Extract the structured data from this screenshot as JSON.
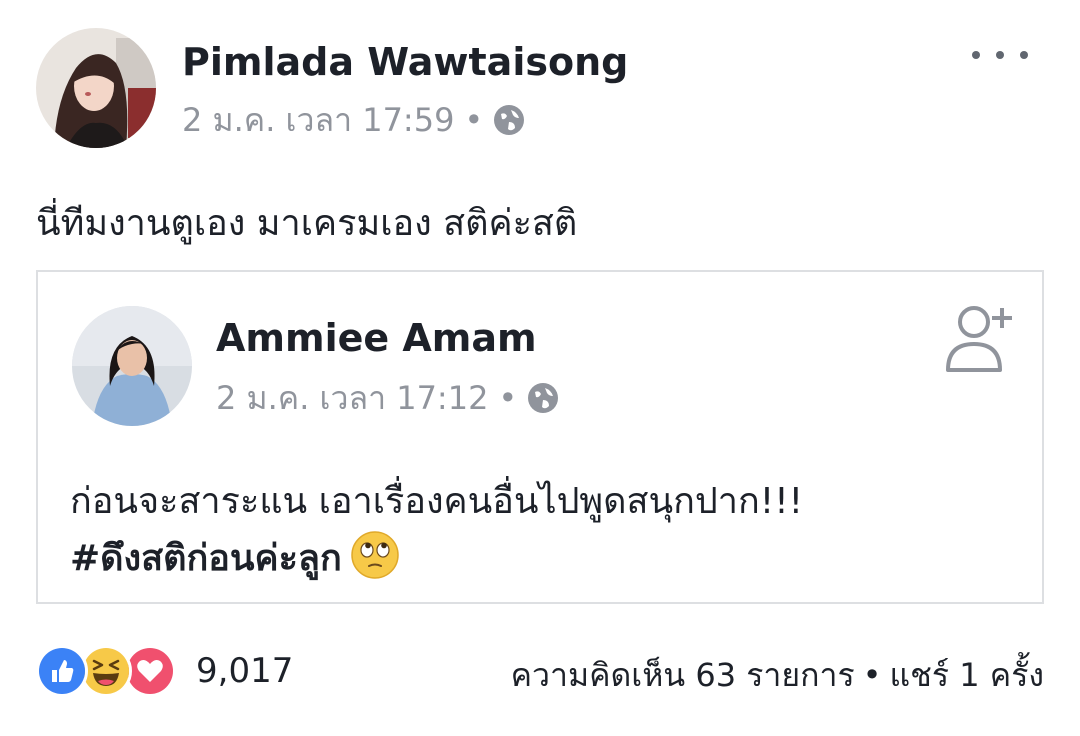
{
  "post": {
    "author": "Pimlada Wawtaisong",
    "timestamp": "2 ม.ค. เวลา 17:59",
    "separator": "•",
    "privacy_icon": "globe-icon",
    "text": "นี่ทีมงานตูเอง มาเครมเอง สติค่ะสติ",
    "more_icon": "more-options-icon"
  },
  "shared_post": {
    "author": "Ammiee Amam",
    "timestamp": "2 ม.ค. เวลา 17:12",
    "separator": "•",
    "privacy_icon": "globe-icon",
    "text_line1": "ก่อนจะสาระแน เอาเรื่องคนอื่นไปพูดสนุกปาก!!!",
    "hashtag": "#ดึงสติก่อนค่ะลูก",
    "emoji": "eye-roll-emoji",
    "follow_icon": "add-friend-icon"
  },
  "footer": {
    "reactions": [
      "like",
      "haha",
      "love"
    ],
    "reaction_count": "9,017",
    "comments": "ความคิดเห็น 63 รายการ",
    "separator": "•",
    "shares": "แชร์ 1 ครั้ง"
  },
  "colors": {
    "like": "#3b82f6",
    "haha": "#f7c948",
    "love": "#f0506e",
    "meta": "#90949c",
    "border": "#dddfe2"
  }
}
